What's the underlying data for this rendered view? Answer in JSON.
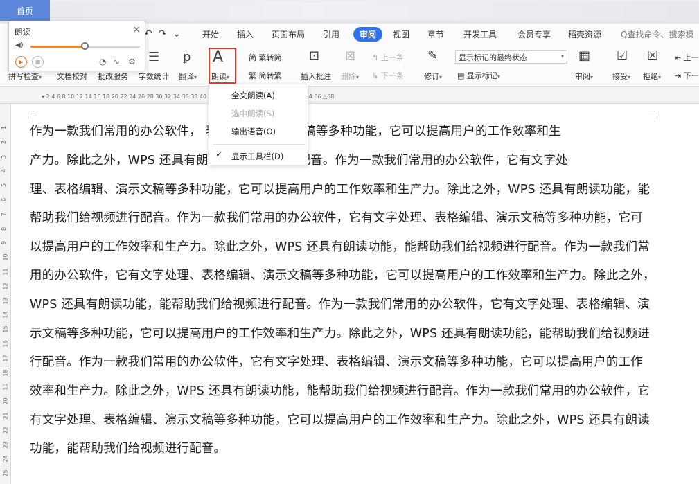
{
  "home_tab": "首页",
  "quick_access": {
    "undo": "↶",
    "redo": "↷",
    "more": "⌄"
  },
  "menu_tabs": [
    "开始",
    "插入",
    "页面布局",
    "引用",
    "审阅",
    "视图",
    "章节",
    "开发工具",
    "会员专享",
    "稻壳资源"
  ],
  "active_tab": "审阅",
  "search_placeholder": "Q查找命令、搜索模",
  "ribbon": {
    "spellcheck": "拼写检查",
    "doc_proofread": "文档校对",
    "batch_service": "批改服务",
    "word_count": "字数统计",
    "translate": "翻译",
    "read_aloud": "朗读",
    "trad_to_simp": "繁转简",
    "simp_to_trad": "简转繁",
    "insert_comment": "插入批注",
    "delete": "删除",
    "prev": "上一条",
    "next": "下一条",
    "track_changes": "修订",
    "display_mode": "显示标记的最终状态",
    "show_markup": "显示标记",
    "review": "审阅",
    "accept": "接受",
    "reject": "拒绝",
    "prev2": "上一",
    "next2": "下一"
  },
  "ruler_ticks": "▾ 2     4     6     8     10    12    14    16    18    20    22    24    26    28    30    32    34    36    38    40    42    44    46    48    50    52    54    56    58    60    62    64    66 △68",
  "vruler_ticks": [
    "1",
    "2",
    "3",
    "4",
    "5",
    "6",
    "7",
    "8",
    "9",
    "10",
    "11",
    "12",
    "13",
    "14",
    "15",
    "16",
    "17",
    "18",
    "19",
    "20",
    "21",
    "22",
    "23",
    "24",
    "25"
  ],
  "dropdown": {
    "items": [
      {
        "label": "全文朗读(A)",
        "enabled": true,
        "checked": false
      },
      {
        "label": "选中朗读(S)",
        "enabled": false,
        "checked": false
      },
      {
        "label": "输出语音(O)",
        "enabled": true,
        "checked": false
      },
      {
        "label": "显示工具栏(D)",
        "enabled": true,
        "checked": true
      }
    ]
  },
  "readaloud_panel": {
    "title": "朗读",
    "close": "×",
    "volume_level": 0.5,
    "accent_color": "#f08a3a"
  },
  "document": {
    "lines": [
      "作为一款我们常用的办公软件，                                         表格编辑、演示文稿等多种功能，它可以提高用户的工作效率和生",
      "产力。除此之外，WPS 还具有朗                         我们给视频进行配音。作为一款我们常用的办公软件，它有文字处",
      "理、表格编辑、演示文稿等多种功能，它可以提高用户的工作效率和生产力。除此之外，WPS 还具有朗读功能，能",
      "帮助我们给视频进行配音。作为一款我们常用的办公软件，它有文字处理、表格编辑、演示文稿等多种功能，它可",
      "以提高用户的工作效率和生产力。除此之外，WPS 还具有朗读功能，能帮助我们给视频进行配音。作为一款我们常",
      "用的办公软件，它有文字处理、表格编辑、演示文稿等多种功能，它可以提高用户的工作效率和生产力。除此之外，",
      "WPS 还具有朗读功能，能帮助我们给视频进行配音。作为一款我们常用的办公软件，它有文字处理、表格编辑、演",
      "示文稿等多种功能，它可以提高用户的工作效率和生产力。除此之外，WPS 还具有朗读功能，能帮助我们给视频进",
      "行配音。作为一款我们常用的办公软件，它有文字处理、表格编辑、演示文稿等多种功能，它可以提高用户的工作",
      "效率和生产力。除此之外，WPS 还具有朗读功能，能帮助我们给视频进行配音。作为一款我们常用的办公软件，它",
      "有文字处理、表格编辑、演示文稿等多种功能，它可以提高用户的工作效率和生产力。除此之外，WPS 还具有朗读",
      "功能，能帮助我们给视频进行配音。"
    ]
  }
}
